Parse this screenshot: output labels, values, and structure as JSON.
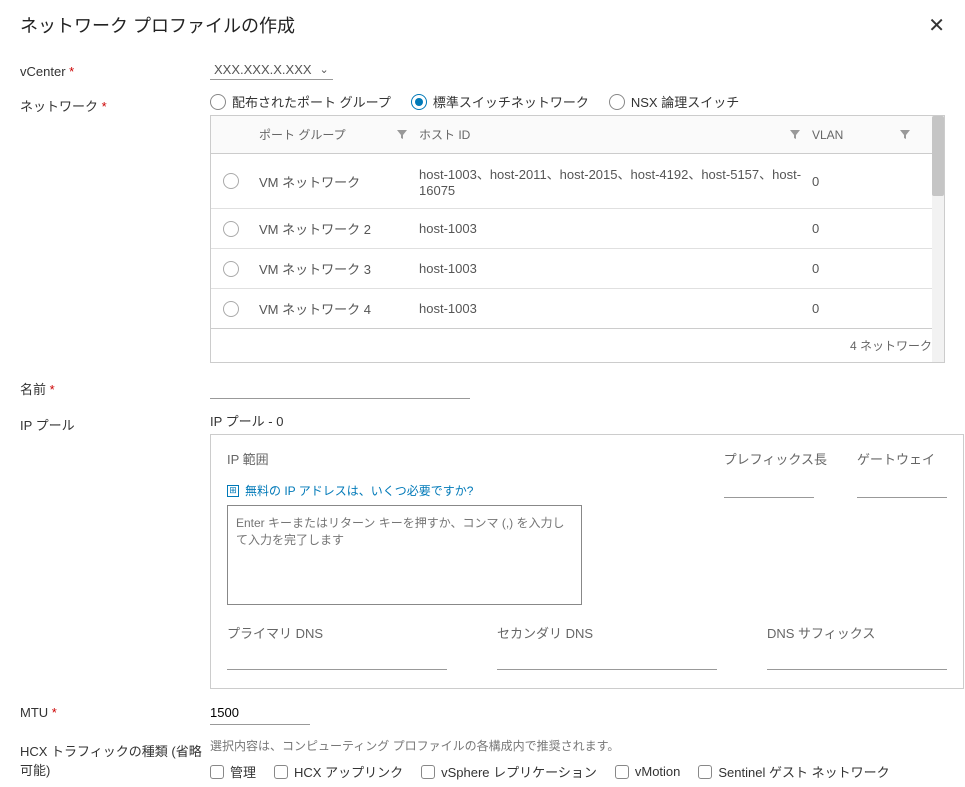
{
  "header": {
    "title": "ネットワーク プロファイルの作成"
  },
  "labels": {
    "vcenter": "vCenter",
    "network": "ネットワーク",
    "name": "名前",
    "ip_pool": "IP プール",
    "mtu": "MTU",
    "traffic_type": "HCX トラフィックの種類 (省略可能)"
  },
  "vcenter": {
    "value": "XXX.XXX.X.XXX"
  },
  "network_type": {
    "options": [
      {
        "label": "配布されたポート グループ",
        "name": "distributed-port-group",
        "selected": false
      },
      {
        "label": "標準スイッチネットワーク",
        "name": "standard-switch-network",
        "selected": true
      },
      {
        "label": "NSX 論理スイッチ",
        "name": "nsx-logical-switch",
        "selected": false
      }
    ]
  },
  "table": {
    "columns": {
      "port_group": "ポート グループ",
      "host_id": "ホスト ID",
      "vlan": "VLAN"
    },
    "rows": [
      {
        "port_group": "VM ネットワーク",
        "host_id": "host-1003、host-2011、host-2015、host-4192、host-5157、host-16075",
        "vlan": "0"
      },
      {
        "port_group": "VM ネットワーク 2",
        "host_id": "host-1003",
        "vlan": "0"
      },
      {
        "port_group": "VM ネットワーク 3",
        "host_id": "host-1003",
        "vlan": "0"
      },
      {
        "port_group": "VM ネットワーク 4",
        "host_id": "host-1003",
        "vlan": "0"
      }
    ],
    "footer": "4 ネットワーク"
  },
  "ip_pool": {
    "title": "IP プール - 0",
    "ip_range_label": "IP 範囲",
    "prefix_label": "プレフィックス長",
    "gateway_label": "ゲートウェイ",
    "help_text": "無料の IP アドレスは、いくつ必要ですか?",
    "range_placeholder": "Enter キーまたはリターン キーを押すか、コンマ (,) を入力して入力を完了します",
    "primary_dns": "プライマリ DNS",
    "secondary_dns": "セカンダリ DNS",
    "dns_suffix": "DNS サフィックス"
  },
  "mtu": {
    "value": "1500"
  },
  "traffic": {
    "hint": "選択内容は、コンピューティング プロファイルの各構成内で推奨されます。",
    "options": [
      {
        "label": "管理",
        "name": "management"
      },
      {
        "label": "HCX アップリンク",
        "name": "hcx-uplink"
      },
      {
        "label": "vSphere レプリケーション",
        "name": "vsphere-replication"
      },
      {
        "label": "vMotion",
        "name": "vmotion"
      },
      {
        "label": "Sentinel ゲスト ネットワーク",
        "name": "sentinel-guest-network"
      }
    ]
  }
}
